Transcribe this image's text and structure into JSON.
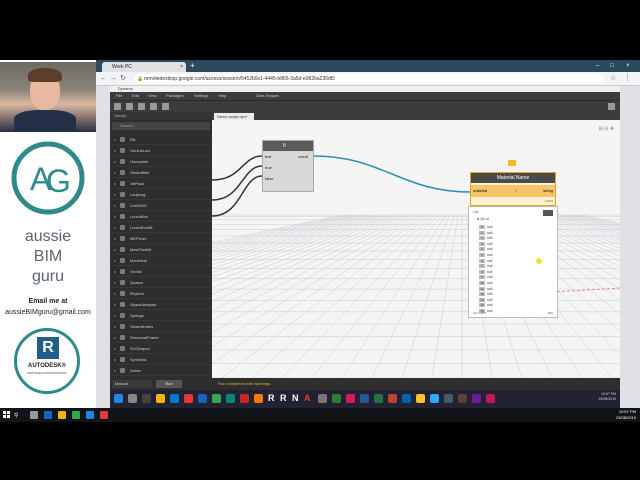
{
  "presenter": {
    "brand_line1": "aussie",
    "brand_line2": "BIM",
    "brand_line3": "guru",
    "email_label": "Email me at",
    "email": "aussieBIMguru@gmail.com",
    "badge_text": "AUTODESK®",
    "badge_subtext": "CERTIFIED PROFESSIONAL",
    "badge_letter": "R",
    "accent_color": "#2f8a8a"
  },
  "browser": {
    "tab_title": "Work PC",
    "tab_close": "×",
    "new_tab": "+",
    "url": "remotedesktop.google.com/access/session/5452b9c1-4445-b865-3a5d-e082ba236df2",
    "window_controls": [
      "–",
      "□",
      "×"
    ]
  },
  "dynamo": {
    "title": "Dynamo",
    "menu": [
      "File",
      "Edit",
      "View",
      "Packages",
      "Settings",
      "Help",
      "",
      "Data Shapes"
    ],
    "library_title": "Library",
    "library_search_placeholder": "Search...",
    "library_items": [
      {
        "label": "Elk"
      },
      {
        "label": "GeniusLoci"
      },
      {
        "label": "Honeybee"
      },
      {
        "label": "Steamfitter"
      },
      {
        "label": "JetPack"
      },
      {
        "label": "Ladybug"
      },
      {
        "label": "LinkDWG"
      },
      {
        "label": "LunchBox"
      },
      {
        "label": "LunchBoxML"
      },
      {
        "label": "MEPover"
      },
      {
        "label": "MeshToolkit"
      },
      {
        "label": "Modelical"
      },
      {
        "label": "Orchid"
      },
      {
        "label": "Quasar"
      },
      {
        "label": "Rhythm"
      },
      {
        "label": "SpaceAnalysis"
      },
      {
        "label": "Springs"
      },
      {
        "label": "SteamNodes"
      },
      {
        "label": "StructuralFrame"
      },
      {
        "label": "SVGImport"
      },
      {
        "label": "Synthetic"
      },
      {
        "label": "Zebra"
      }
    ],
    "canvas_tab": "Demo script.dyn*",
    "if_node": {
      "icon": "If",
      "inputs": [
        "test",
        "true",
        "false"
      ],
      "output": "result"
    },
    "material_node": {
      "title": "Material.Name",
      "input": "material",
      "output": "string",
      "footer": "AUTO"
    },
    "watch": {
      "header": "List",
      "sub": "■ @List",
      "rows": [
        {
          "idx": "0",
          "val": "null"
        },
        {
          "idx": "1",
          "val": "null"
        },
        {
          "idx": "2",
          "val": "null"
        },
        {
          "idx": "3",
          "val": "null"
        },
        {
          "idx": "4",
          "val": "null"
        },
        {
          "idx": "5",
          "val": "null"
        },
        {
          "idx": "6",
          "val": "null"
        },
        {
          "idx": "7",
          "val": "null"
        },
        {
          "idx": "8",
          "val": "null"
        },
        {
          "idx": "9",
          "val": "null"
        },
        {
          "idx": "10",
          "val": "null"
        },
        {
          "idx": "11",
          "val": "null"
        },
        {
          "idx": "12",
          "val": "null"
        },
        {
          "idx": "13",
          "val": "null"
        },
        {
          "idx": "14",
          "val": "null"
        },
        {
          "idx": "15",
          "val": "null"
        }
      ],
      "footer": "@L2 @L1",
      "count": "{98}"
    },
    "run_mode": "Manual",
    "run_label": "Run",
    "run_status": "Run completed with warnings."
  },
  "remote_clock": {
    "time": "10:57 PM",
    "date": "23/08/2019"
  },
  "host_clock": {
    "time": "10:57 PM",
    "date": "23/08/2019"
  },
  "colors": {
    "taskbar": "#101418",
    "browser_chrome": "#2b4a5e",
    "dynamo_dark": "#2e2e2e",
    "node_accent": "#f7c46a"
  }
}
